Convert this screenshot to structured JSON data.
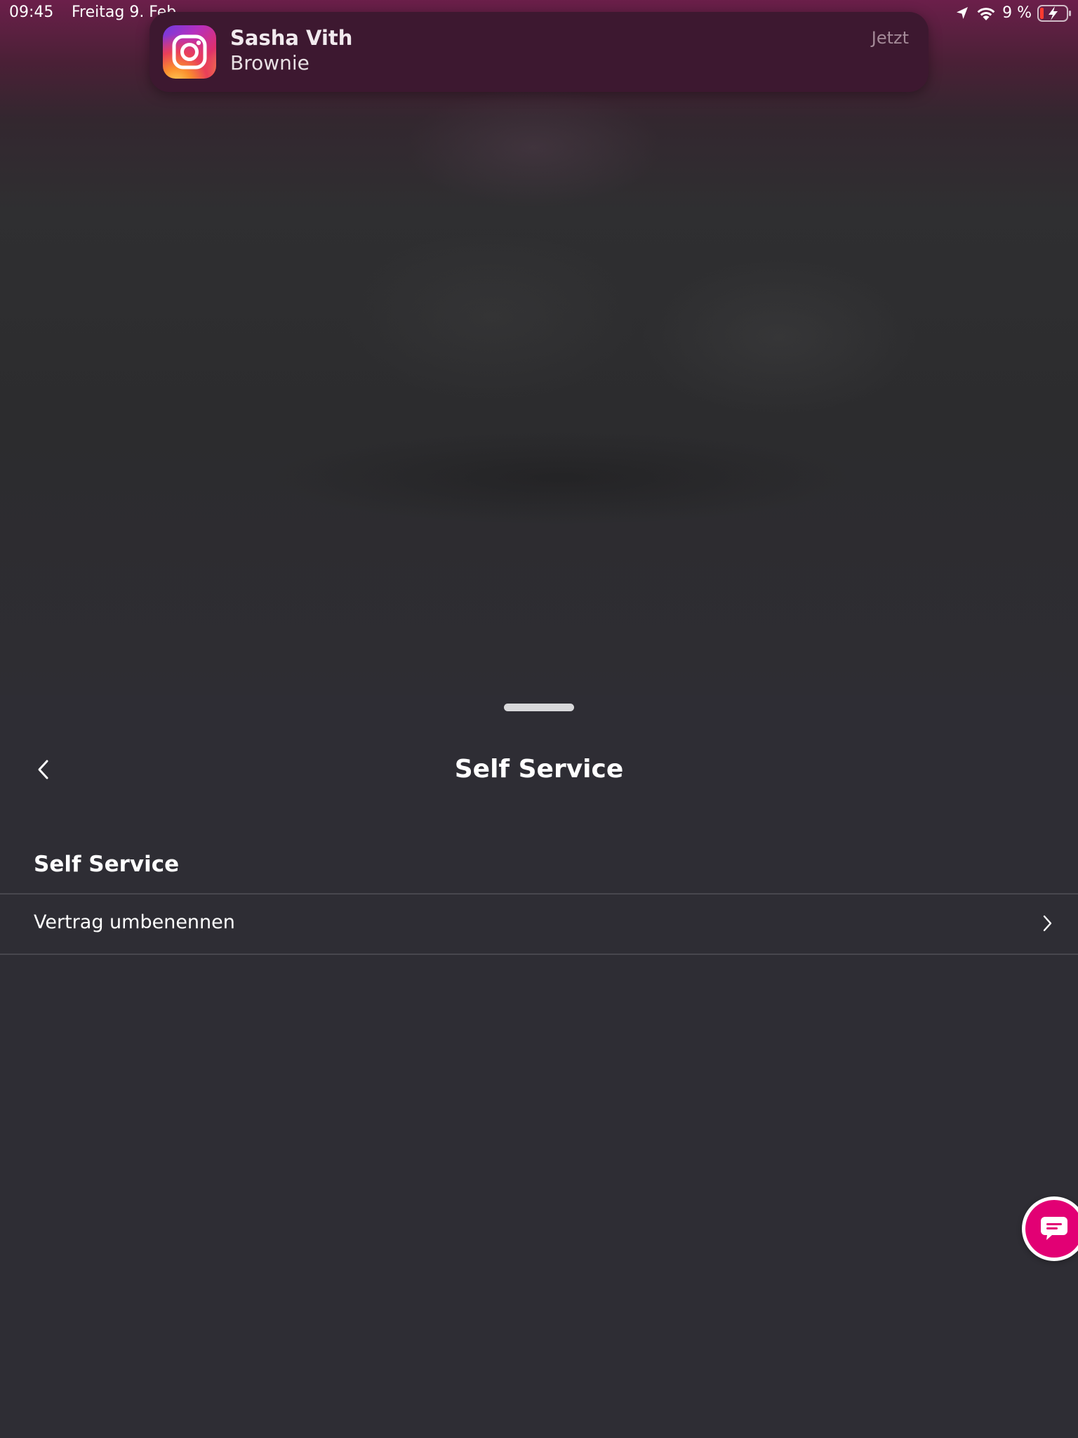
{
  "status_bar": {
    "time": "09:45",
    "date": "Freitag 9. Feb",
    "battery_percent": "9 %",
    "icons": [
      "location-arrow-icon",
      "wifi-icon",
      "battery-charging-icon"
    ]
  },
  "notification": {
    "app_icon": "instagram-icon",
    "title": "Sasha Vith",
    "body": "Brownie",
    "time": "Jetzt"
  },
  "sheet": {
    "nav_title": "Self Service",
    "back_icon": "chevron-left-icon",
    "section_header": "Self Service",
    "rows": [
      {
        "label": "Vertrag umbenennen",
        "icon": "chevron-right-icon"
      }
    ]
  },
  "chat_button": {
    "icon": "chat-bubble-icon",
    "color": "#e20074"
  },
  "colors": {
    "background": "#2e2d34",
    "accent": "#e20074",
    "notification_bg": "#3d1830"
  }
}
